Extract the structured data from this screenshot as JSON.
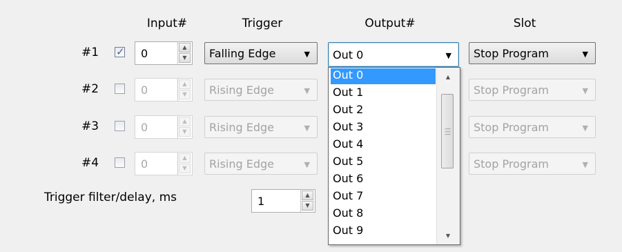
{
  "headers": {
    "input": "Input#",
    "trigger": "Trigger",
    "output": "Output#",
    "slot": "Slot"
  },
  "rows": [
    {
      "label": "#1",
      "checked": true,
      "input": "0",
      "trigger": "Falling Edge",
      "output": "Out 0",
      "slot": "Stop Program"
    },
    {
      "label": "#2",
      "checked": false,
      "input": "0",
      "trigger": "Rising Edge",
      "output": "",
      "slot": "Stop Program"
    },
    {
      "label": "#3",
      "checked": false,
      "input": "0",
      "trigger": "Rising Edge",
      "output": "",
      "slot": "Stop Program"
    },
    {
      "label": "#4",
      "checked": false,
      "input": "0",
      "trigger": "Rising Edge",
      "output": "",
      "slot": "Stop Program"
    }
  ],
  "filter": {
    "label": "Trigger filter/delay, ms",
    "value": "1"
  },
  "dropdown": {
    "options": [
      "Out 0",
      "Out 1",
      "Out 2",
      "Out 3",
      "Out 4",
      "Out 5",
      "Out 6",
      "Out 7",
      "Out 8",
      "Out 9"
    ],
    "selected": "Out 0"
  },
  "icons": {
    "checkbox_mark": "✓",
    "combo_arrow": "▼",
    "spin_up": "▲",
    "spin_down": "▼",
    "scroll_up": "▲",
    "scroll_down": "▼"
  },
  "colors": {
    "selection": "#3399ff",
    "checkmark": "#4a5fa8"
  }
}
